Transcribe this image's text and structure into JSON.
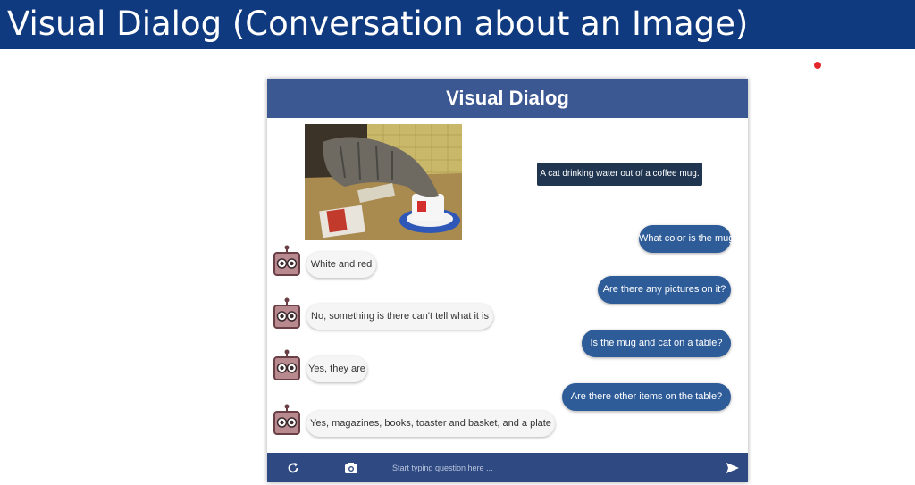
{
  "slide": {
    "title": "Visual Dialog (Conversation about an Image)"
  },
  "app": {
    "title": "Visual Dialog",
    "caption": "A cat drinking water out of a coffee mug.",
    "dialog": [
      {
        "question": "What color is the mug?",
        "answer": "White and red"
      },
      {
        "question": "Are there any pictures on it?",
        "answer": "No, something is there can't tell what it is"
      },
      {
        "question": "Is the mug and cat on a table?",
        "answer": "Yes, they are"
      },
      {
        "question": "Are there other items on the table?",
        "answer": "Yes, magazines, books, toaster and basket, and a plate"
      }
    ],
    "input": {
      "placeholder": "Start typing question here ...",
      "value": ""
    },
    "icons": {
      "refresh": "refresh-icon",
      "camera": "camera-icon",
      "send": "send-icon",
      "bot": "robot-avatar-icon"
    }
  },
  "colors": {
    "slide_header": "#0f3a7f",
    "app_header": "#3c5893",
    "question_bubble": "#2e5c99",
    "caption_box": "#1f3550",
    "answer_bubble": "#f5f5f5",
    "input_bar": "#2f4a82",
    "laser_pointer": "#e3242b"
  }
}
